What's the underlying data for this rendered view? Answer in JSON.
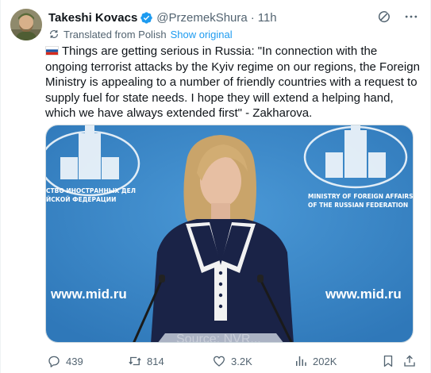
{
  "author": {
    "name": "Takeshi Kovacs",
    "handle": "@PrzemekShura",
    "separator": "·",
    "time": "11h"
  },
  "translation": {
    "label": "Translated from Polish",
    "show_original": "Show original"
  },
  "tweet": {
    "flag": "Russia",
    "text": "Things are getting serious in Russia: \"In connection with the ongoing terrorist attacks by the Kyiv regime on our regions, the Foreign Ministry is appealing to a number of friendly countries with a request to supply fuel for state needs. I hope they will extend a helping hand, which we have always extended first\" - Zakharova."
  },
  "media": {
    "backdrop_left_text": [
      "СТВО ИНОСТРАННЫХ ДЕЛ",
      "ЙСКОЙ ФЕДЕРАЦИИ"
    ],
    "backdrop_right_text": [
      "MINISTRY OF FOREIGN AFFAIRS",
      "OF THE RUSSIAN FEDERATION"
    ],
    "website_left": "www.mid.ru",
    "website_right": "www.mid.ru",
    "watermark": "Source: NVR..."
  },
  "engagement": {
    "replies": "439",
    "reposts": "814",
    "likes": "3.2K",
    "views": "202K"
  },
  "icons": {
    "verified": "verified-badge-icon",
    "grok": "grok-icon",
    "more": "more-icon",
    "translate": "translate-icon",
    "reply": "reply-icon",
    "repost": "repost-icon",
    "like": "heart-icon",
    "views": "views-icon",
    "bookmark": "bookmark-icon",
    "share": "share-icon"
  },
  "colors": {
    "accent": "#1d9bf0",
    "secondary_text": "#536471",
    "backdrop_blue": "#3d8ac9"
  }
}
